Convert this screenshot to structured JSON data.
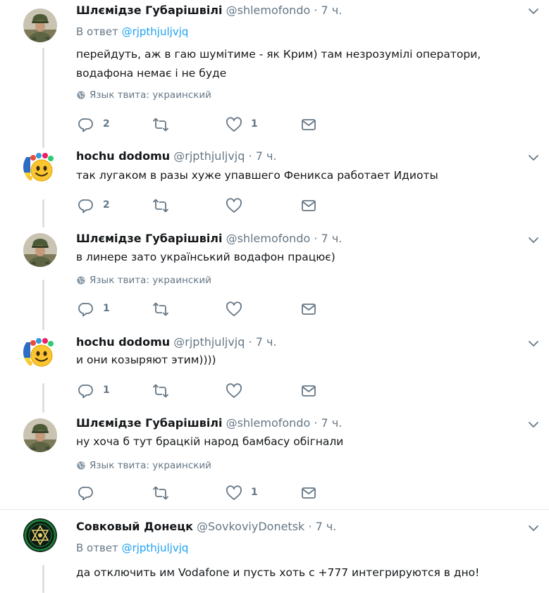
{
  "colors": {
    "accent": "#1da1f2",
    "secondary_text": "#657786",
    "primary_text": "#14171a",
    "thread_line": "#dbe0e4"
  },
  "icons": {
    "reply": "reply-icon",
    "retweet": "retweet-icon",
    "like": "heart-icon",
    "dm": "envelope-icon",
    "menu": "chevron-down-icon",
    "globe": "globe-icon"
  },
  "tweets": [
    {
      "name": "Шлємідзе Губарішвілі",
      "handle": "@shlemofondo",
      "dot": "·",
      "time": "7 ч.",
      "reply_prefix": "В ответ",
      "reply_to": "@rjpthjuljvjq",
      "text": "перейдуть, аж в гаю шумітиме - як Крим) там незрозумілі оператори, водафона немає і не буде",
      "lang": "Язык твита: украинский",
      "replies": "2",
      "retweets": "",
      "likes": "1"
    },
    {
      "name": "hochu dodomu",
      "handle": "@rjpthjuljvjq",
      "dot": "·",
      "time": "7 ч.",
      "text": "так лугаком в разы хуже упавшего Феникса работает Идиоты",
      "replies": "2",
      "retweets": "",
      "likes": ""
    },
    {
      "name": "Шлємідзе Губарішвілі",
      "handle": "@shlemofondo",
      "dot": "·",
      "time": "7 ч.",
      "text": "в линере зато український водафон працює)",
      "lang": "Язык твита: украинский",
      "replies": "1",
      "retweets": "",
      "likes": ""
    },
    {
      "name": "hochu dodomu",
      "handle": "@rjpthjuljvjq",
      "dot": "·",
      "time": "7 ч.",
      "text": "и они козыряют этим))))",
      "replies": "1",
      "retweets": "",
      "likes": ""
    },
    {
      "name": "Шлємідзе Губарішвілі",
      "handle": "@shlemofondo",
      "dot": "·",
      "time": "7 ч.",
      "text": "ну хоча б тут брацкій народ бамбасу обігнали",
      "lang": "Язык твита: украинский",
      "replies": "",
      "retweets": "",
      "likes": "1"
    },
    {
      "name": "Совковый Донецк",
      "handle": "@SovkoviyDonetsk",
      "dot": "·",
      "time": "7 ч.",
      "reply_prefix": "В ответ",
      "reply_to": "@rjpthjuljvjq",
      "text": "да отключить им Vodafone и пусть хоть с +777 интегрируются в дно!"
    }
  ]
}
